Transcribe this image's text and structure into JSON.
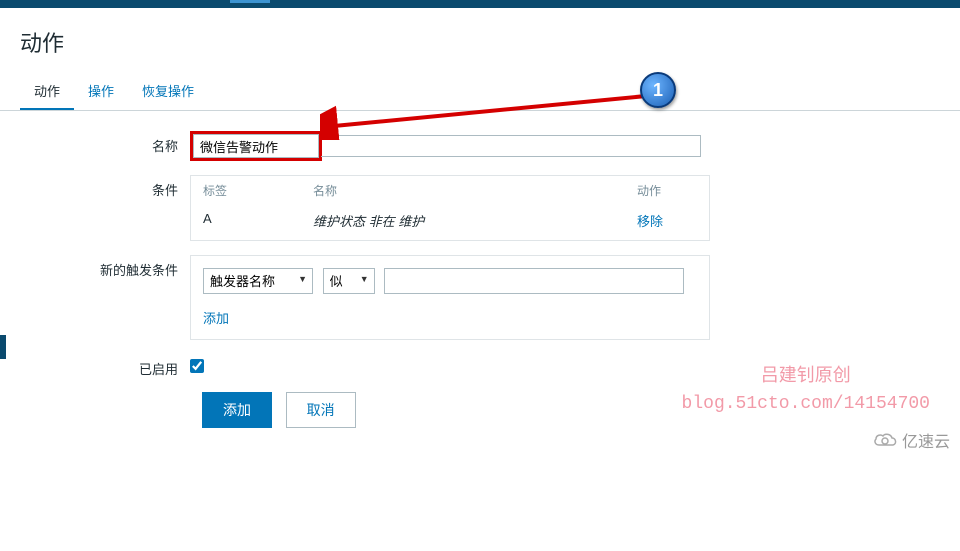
{
  "page": {
    "title": "动作"
  },
  "tabs": [
    {
      "label": "动作",
      "active": true
    },
    {
      "label": "操作",
      "active": false
    },
    {
      "label": "恢复操作",
      "active": false
    }
  ],
  "form": {
    "name_label": "名称",
    "name_value": "微信告警动作",
    "cond_label": "条件",
    "cond_headers": {
      "tag": "标签",
      "name": "名称",
      "action": "动作"
    },
    "cond_row": {
      "tag": "A",
      "name": "维护状态 非在 维护",
      "action": "移除"
    },
    "trigger_label": "新的触发条件",
    "trigger_select1": "触发器名称",
    "trigger_select2": "似",
    "trigger_value": "",
    "add_link": "添加",
    "enabled_label": "已启用",
    "enabled_checked": true,
    "submit": "添加",
    "cancel": "取消"
  },
  "callout": {
    "number": "1"
  },
  "watermark": {
    "line1": "吕建钊原创",
    "line2": "blog.51cto.com/14154700"
  },
  "logo": "亿速云"
}
